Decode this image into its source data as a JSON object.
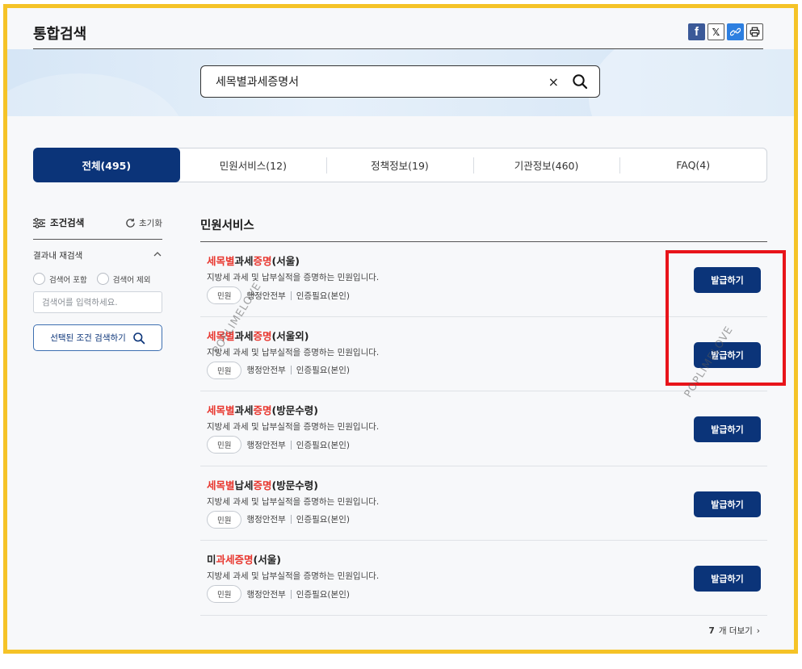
{
  "page": {
    "title": "통합검색"
  },
  "share": {
    "facebook": "f",
    "x": "𝕏",
    "link": "🔗",
    "print": "🖶"
  },
  "search": {
    "query": "세목별과세증명서",
    "clear": "×"
  },
  "tabs": [
    {
      "label": "전체(495)",
      "active": true
    },
    {
      "label": "민원서비스(12)",
      "active": false
    },
    {
      "label": "정책정보(19)",
      "active": false
    },
    {
      "label": "기관정보(460)",
      "active": false
    },
    {
      "label": "FAQ(4)",
      "active": false
    }
  ],
  "sidebar": {
    "title": "조건검색",
    "reset": "초기화",
    "refine_title": "결과내 재검색",
    "include_label": "검색어 포함",
    "exclude_label": "검색어 제외",
    "input_placeholder": "검색어를 입력하세요.",
    "search_button": "선택된 조건 검색하기"
  },
  "section": {
    "title": "민원서비스"
  },
  "results": [
    {
      "name": [
        [
          "세목별",
          true
        ],
        [
          "과세",
          false
        ],
        [
          "증명",
          true
        ],
        [
          "(서울)",
          false
        ]
      ],
      "desc": "지방세 과세 및 납부실적을 증명하는 민원입니다.",
      "chip": "민원",
      "org": "행정안전부",
      "auth": "인증필요(본인)",
      "button": "발급하기"
    },
    {
      "name": [
        [
          "세목별",
          true
        ],
        [
          "과세",
          false
        ],
        [
          "증명",
          true
        ],
        [
          "(서울외)",
          false
        ]
      ],
      "desc": "지방세 과세 및 납부실적을 증명하는 민원입니다.",
      "chip": "민원",
      "org": "행정안전부",
      "auth": "인증필요(본인)",
      "button": "발급하기"
    },
    {
      "name": [
        [
          "세목별",
          true
        ],
        [
          "과세",
          false
        ],
        [
          "증명",
          true
        ],
        [
          "(방문수령)",
          false
        ]
      ],
      "desc": "지방세 과세 및 납부실적을 증명하는 민원입니다.",
      "chip": "민원",
      "org": "행정안전부",
      "auth": "인증필요(본인)",
      "button": "발급하기"
    },
    {
      "name": [
        [
          "세목별",
          true
        ],
        [
          "납세",
          false
        ],
        [
          "증명",
          true
        ],
        [
          "(방문수령)",
          false
        ]
      ],
      "desc": "지방세 과세 및 납부실적을 증명하는 민원입니다.",
      "chip": "민원",
      "org": "행정안전부",
      "auth": "인증필요(본인)",
      "button": "발급하기"
    },
    {
      "name": [
        [
          "미",
          false
        ],
        [
          "과세증명",
          true
        ],
        [
          "(서울)",
          false
        ]
      ],
      "desc": "지방세 과세 및 납부실적을 증명하는 민원입니다.",
      "chip": "민원",
      "org": "행정안전부",
      "auth": "인증필요(본인)",
      "button": "발급하기"
    }
  ],
  "more": {
    "count": "7",
    "label": "개 더보기",
    "arrow": "›"
  },
  "watermark": "POPLIMELOVE",
  "colors": {
    "accent": "#0b3479",
    "highlight": "#e8372f",
    "frame": "#f5c327",
    "annotation": "#e8141a"
  }
}
